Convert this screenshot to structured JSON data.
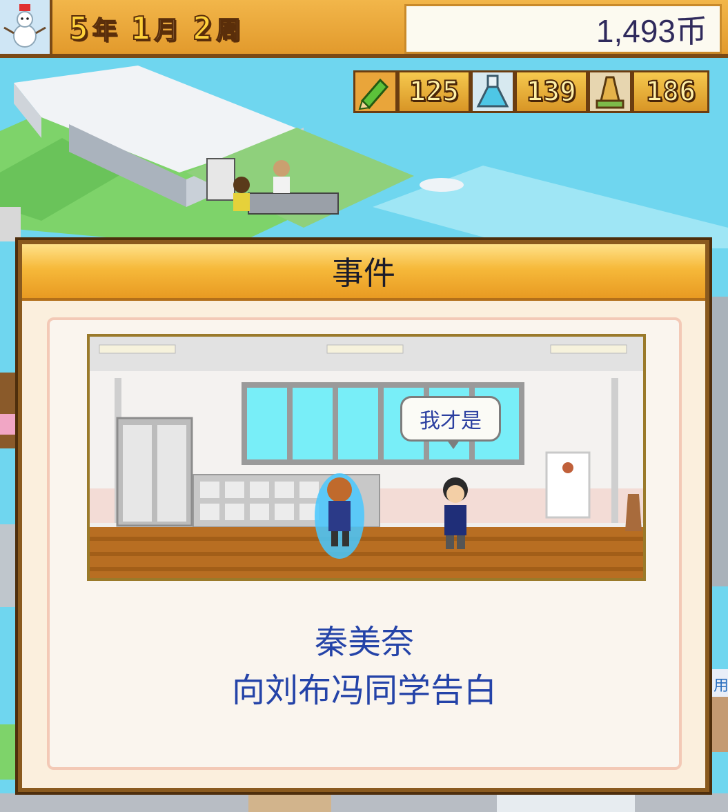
{
  "hud": {
    "season_icon": "snowman-icon",
    "date": {
      "year": "5",
      "year_unit": "年",
      "month": "1",
      "month_unit": "月",
      "week": "2",
      "week_unit": "周"
    },
    "money": "1,493币"
  },
  "stats": [
    {
      "icon": "pencil-icon",
      "value": "125"
    },
    {
      "icon": "flask-icon",
      "value": "139"
    },
    {
      "icon": "trophy-icon",
      "value": "186"
    }
  ],
  "dialog": {
    "title": "事件",
    "speech": "我才是",
    "message_line1": "秦美奈",
    "message_line2": "向刘布冯同学告白"
  },
  "background_fragment": "用",
  "colors": {
    "hud_orange": "#e8a235",
    "dialog_blue_text": "#2443a8",
    "water": "#6fd6ef",
    "grass": "#7ed36a"
  }
}
